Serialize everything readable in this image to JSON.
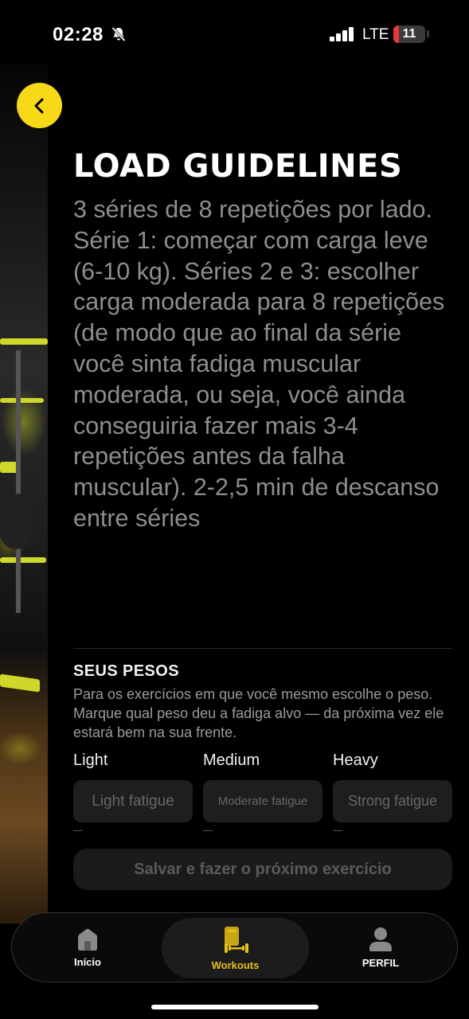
{
  "status_bar": {
    "time": "02:28",
    "network": "LTE",
    "battery": "11",
    "battery_level": 0.11,
    "silent_icon": "bell-slash-icon",
    "signal_icon": "cellular-signal-icon"
  },
  "header": {
    "back_icon": "chevron-left-icon",
    "accent_color": "#f7d917"
  },
  "section": {
    "title": "LOAD GUIDELINES",
    "description": "3 séries de 8 repetições por lado. Série 1: começar com carga leve (6-10 kg). Séries 2 e 3: escolher carga moderada para 8 repetições (de modo que ao final da série você sinta fadiga muscular moderada, ou seja, você ainda conseguiria fazer mais 3-4 repetições antes da falha muscular). 2-2,5 min de descanso entre séries"
  },
  "weights": {
    "title": "SEUS PESOS",
    "description": "Para os exercícios em que você mesmo escolhe o peso. Marque qual peso deu a fadiga alvo — da próxima vez ele estará bem na sua frente.",
    "fields": [
      {
        "label": "Light",
        "placeholder": "Light fatigue"
      },
      {
        "label": "Medium",
        "placeholder": "Moderate fatigue"
      },
      {
        "label": "Heavy",
        "placeholder": "Strong fatigue"
      }
    ]
  },
  "save_button": {
    "label": "Salvar e fazer o próximo exercício"
  },
  "tab_bar": {
    "tabs": [
      {
        "label": "Início",
        "icon": "home-icon",
        "active": false
      },
      {
        "label": "Workouts",
        "icon": "dumbbell-icon",
        "active": true
      },
      {
        "label": "PERFIL",
        "icon": "person-icon",
        "active": false
      }
    ],
    "active_color": "#f7d917"
  }
}
